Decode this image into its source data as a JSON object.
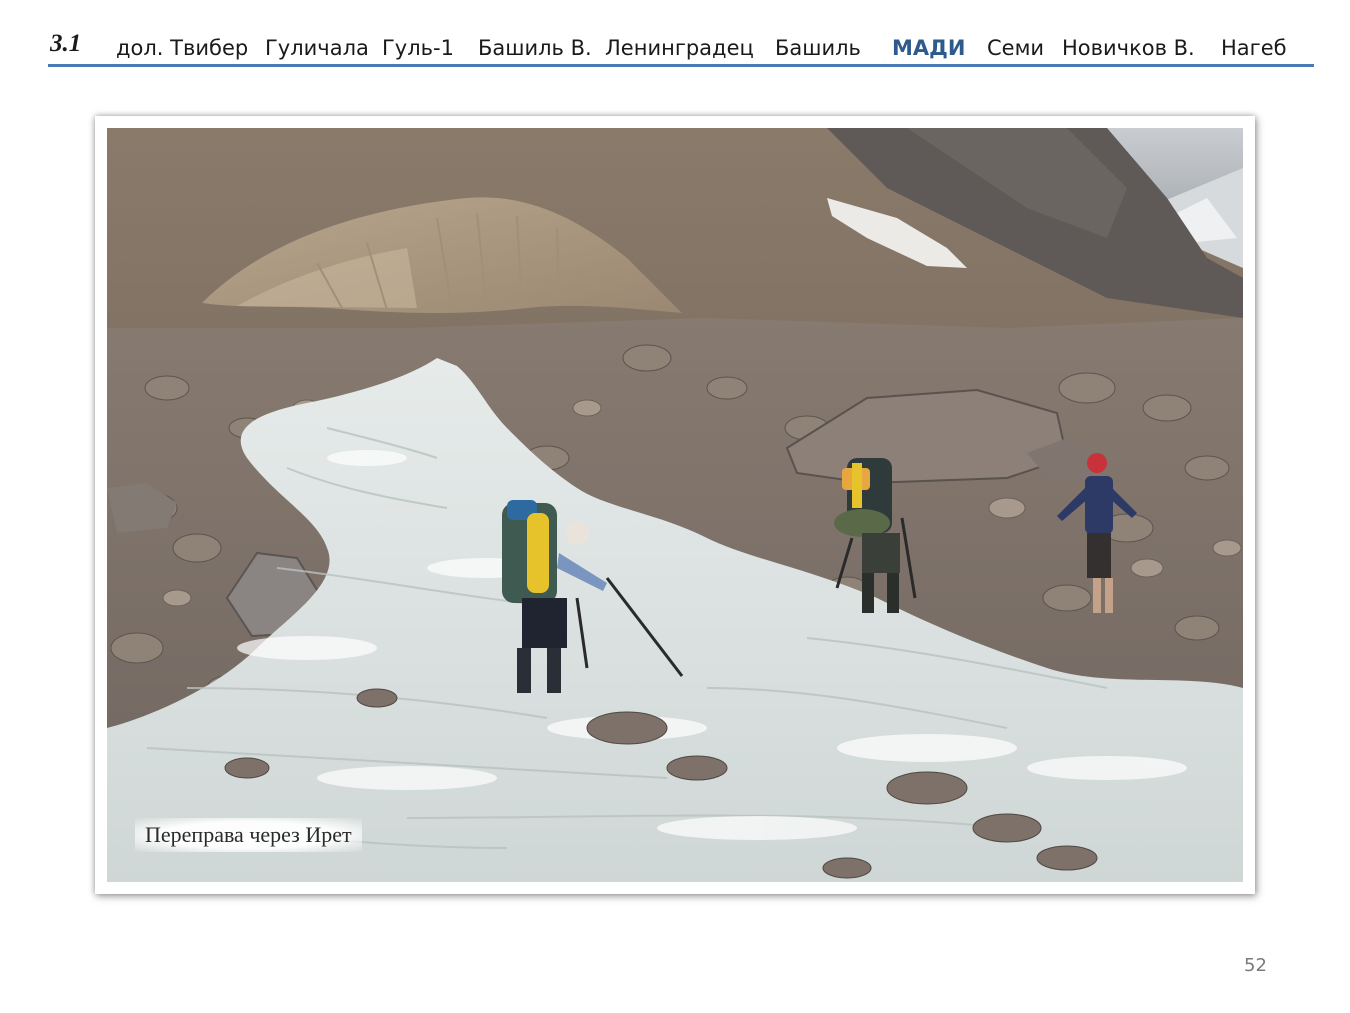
{
  "header": {
    "section_number": "3.1",
    "nav": [
      {
        "label": "дол. Твибер",
        "active": false
      },
      {
        "label": "Гуличала",
        "active": false
      },
      {
        "label": "Гуль-1",
        "active": false
      },
      {
        "label": "Башиль В.",
        "active": false
      },
      {
        "label": "Ленинградец",
        "active": false
      },
      {
        "label": "Башиль",
        "active": false
      },
      {
        "label": "МАДИ",
        "active": true
      },
      {
        "label": "Семи",
        "active": false
      },
      {
        "label": "Новичков В.",
        "active": false
      },
      {
        "label": "Нагеб",
        "active": false
      }
    ]
  },
  "photo": {
    "caption": "Переправа через Ирет"
  },
  "page_number": "52",
  "colors": {
    "accent": "#4a7bb7",
    "active_nav": "#2f5b8c"
  }
}
